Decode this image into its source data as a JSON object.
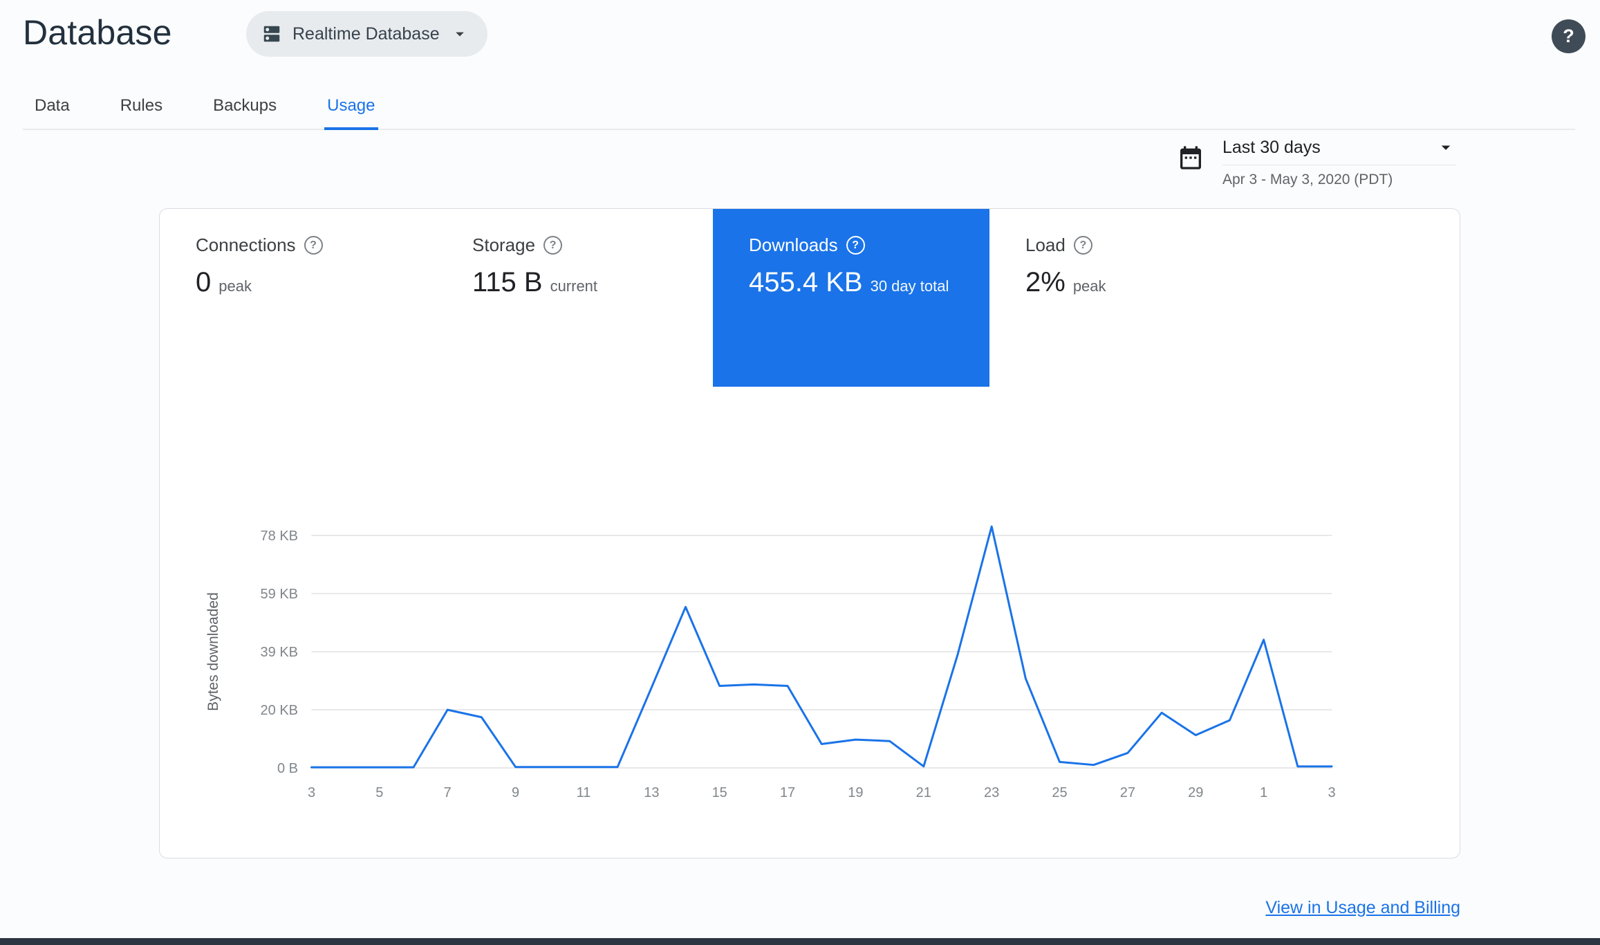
{
  "header": {
    "title": "Database",
    "db_selector_label": "Realtime Database"
  },
  "icons": {
    "help": "?"
  },
  "tabs": [
    {
      "label": "Data",
      "active": false
    },
    {
      "label": "Rules",
      "active": false
    },
    {
      "label": "Backups",
      "active": false
    },
    {
      "label": "Usage",
      "active": true
    }
  ],
  "date_range": {
    "label": "Last 30 days",
    "detail": "Apr 3 - May 3, 2020 (PDT)"
  },
  "metrics": [
    {
      "label": "Connections",
      "value": "0",
      "suffix": "peak",
      "selected": false
    },
    {
      "label": "Storage",
      "value": "115 B",
      "suffix": "current",
      "selected": false
    },
    {
      "label": "Downloads",
      "value": "455.4 KB",
      "suffix": "30 day total",
      "selected": true
    },
    {
      "label": "Load",
      "value": "2%",
      "suffix": "peak",
      "selected": false
    }
  ],
  "chart_data": {
    "type": "line",
    "title": "Downloads",
    "ylabel": "Bytes downloaded",
    "xlabel": "",
    "unit": "KB",
    "x_tick_labels": [
      "3",
      "5",
      "7",
      "9",
      "11",
      "13",
      "15",
      "17",
      "19",
      "21",
      "23",
      "25",
      "27",
      "29",
      "1",
      "3"
    ],
    "y_tick_labels": [
      "78 KB",
      "59 KB",
      "39 KB",
      "20 KB",
      "0 B"
    ],
    "ylim_kb": [
      0,
      78
    ],
    "x_days": [
      "Apr 3",
      "Apr 4",
      "Apr 5",
      "Apr 6",
      "Apr 7",
      "Apr 8",
      "Apr 9",
      "Apr 10",
      "Apr 11",
      "Apr 12",
      "Apr 13",
      "Apr 14",
      "Apr 15",
      "Apr 16",
      "Apr 17",
      "Apr 18",
      "Apr 19",
      "Apr 20",
      "Apr 21",
      "Apr 22",
      "Apr 23",
      "Apr 24",
      "Apr 25",
      "Apr 26",
      "Apr 27",
      "Apr 28",
      "Apr 29",
      "Apr 30",
      "May 1",
      "May 2",
      "May 3"
    ],
    "values_kb": [
      0.2,
      0.2,
      0.2,
      0.2,
      19.5,
      17,
      0.3,
      0.3,
      0.3,
      0.3,
      27,
      54,
      27.5,
      28,
      27.5,
      8,
      9.5,
      9,
      0.5,
      38,
      81,
      30,
      2,
      1,
      5,
      18.5,
      11,
      16,
      43,
      0.5,
      0.5
    ],
    "line_color": "#1a73e8",
    "grid": true,
    "legend": "none"
  },
  "footer": {
    "link": "View in Usage and Billing"
  },
  "colors": {
    "accent": "#1a73e8",
    "selected_tile_bg": "#1a73e8",
    "grid_line": "#e0e0e0",
    "tick_label": "#80868b",
    "axis_title": "#5f6368"
  }
}
